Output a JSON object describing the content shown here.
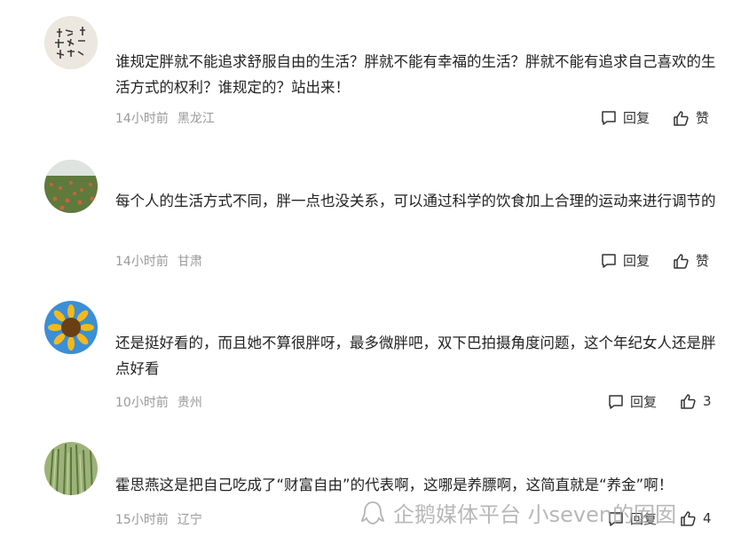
{
  "comments": [
    {
      "text": "谁规定胖就不能追求舒服自由的生活？胖就不能有幸福的生活？胖就不能有追求自己喜欢的生活方式的权利？谁规定的？站出来！",
      "time": "14小时前",
      "location": "黑龙江",
      "reply_label": "回复",
      "like_label": "赞",
      "avatar": "calligraphy-avatar"
    },
    {
      "text": "每个人的生活方式不同，胖一点也没关系，可以通过科学的饮食加上合理的运动来进行调节的",
      "time": "14小时前",
      "location": "甘肃",
      "reply_label": "回复",
      "like_label": "赞",
      "avatar": "flower-field-avatar"
    },
    {
      "text": "还是挺好看的，而且她不算很胖呀，最多微胖吧，双下巴拍摄角度问题，这个年纪女人还是胖点好看",
      "time": "10小时前",
      "location": "贵州",
      "reply_label": "回复",
      "like_label": "3",
      "avatar": "sunflower-avatar"
    },
    {
      "text": "霍思燕这是把自己吃成了“财富自由”的代表啊，这哪是养膘啊，这简直就是“养金”啊！",
      "time": "15小时前",
      "location": "辽宁",
      "reply_label": "回复",
      "like_label": "4",
      "avatar": "wheat-avatar"
    }
  ],
  "watermark": "企鹅媒体平台 小seven的囡囡",
  "colors": {
    "text": "#222222",
    "meta": "#999999"
  }
}
